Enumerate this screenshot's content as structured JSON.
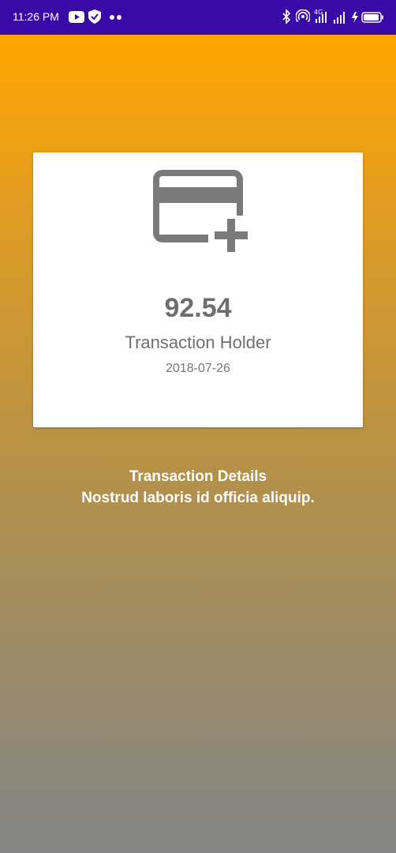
{
  "status_bar": {
    "time": "11:26 PM",
    "left_icons": [
      "youtube-icon",
      "shield-check-icon",
      "more-dots-icon"
    ],
    "right_icons": [
      "bluetooth-icon",
      "hotspot-icon",
      "signal-4g-icon",
      "signal-icon",
      "battery-charging-icon"
    ]
  },
  "card": {
    "icon": "credit-card-add-icon",
    "amount": "92.54",
    "holder": "Transaction Holder",
    "date": "2018-07-26"
  },
  "details": {
    "title": "Transaction Details",
    "description": "Nostrud laboris id officia aliquip."
  },
  "colors": {
    "status_bar": "#3a0aa8",
    "gradient_top": "#ffa600",
    "gradient_bottom": "#858585",
    "card_background": "#ffffff",
    "icon_gray": "#7a7a7a"
  }
}
